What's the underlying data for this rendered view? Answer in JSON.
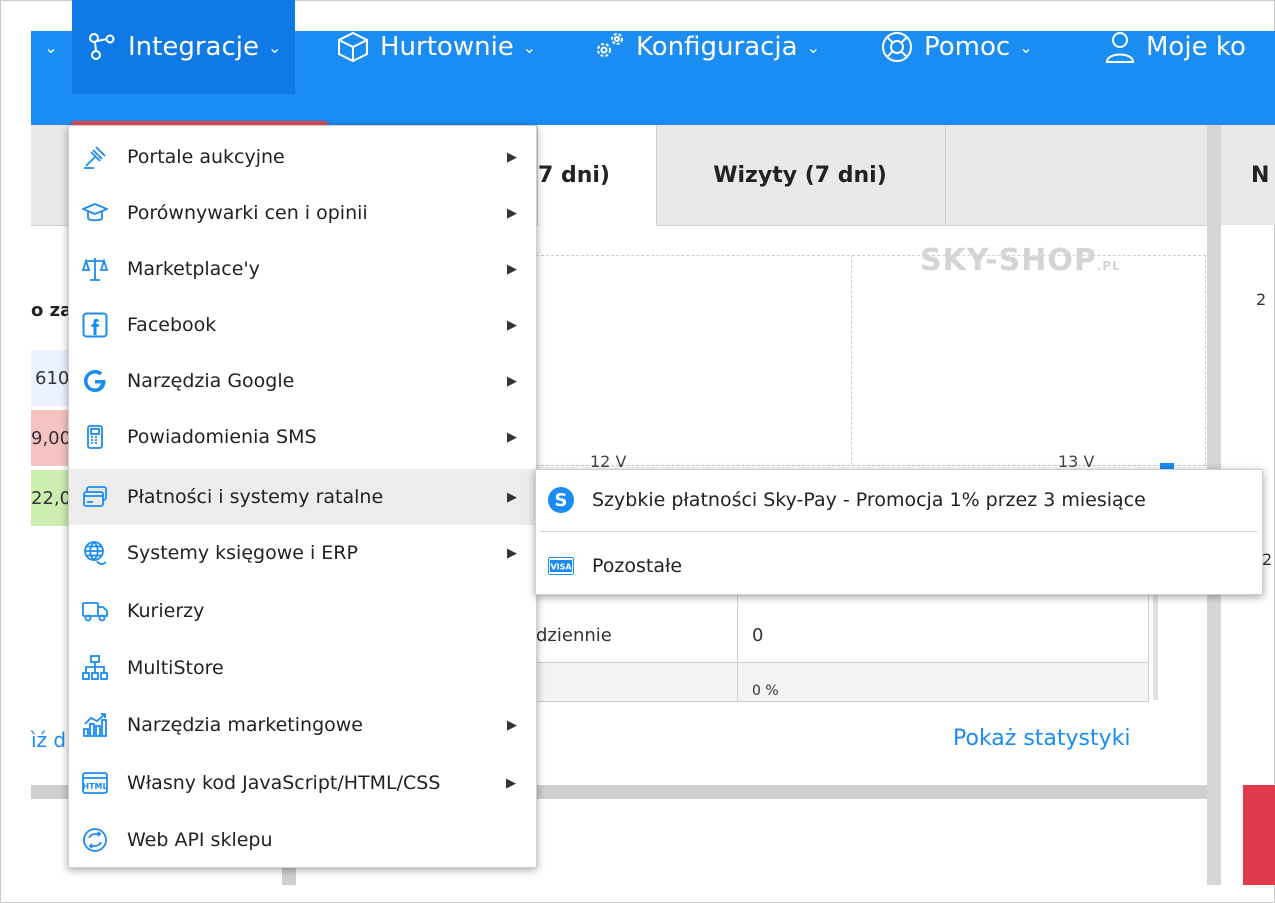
{
  "nav": {
    "items": [
      {
        "label": "Integracje",
        "icon": "integrations-icon"
      },
      {
        "label": "Hurtownie",
        "icon": "box-icon"
      },
      {
        "label": "Konfiguracja",
        "icon": "gears-icon"
      },
      {
        "label": "Pomoc",
        "icon": "lifebuoy-icon"
      },
      {
        "label": "Moje ko",
        "icon": "user-icon"
      }
    ],
    "colors": {
      "bar": "#1a8cf2",
      "active": "#0f79e6",
      "underline": "#e24a50"
    }
  },
  "background": {
    "tab_partial": "7 dni)",
    "tab_visits": "Wizyty (7 dni)",
    "tab_right": "N",
    "watermark": "SKY-SHOP",
    "watermark_suffix": ".PL",
    "axis_left": "12 V",
    "axis_right": "13 V",
    "left_header": "o za",
    "left_val1": "610",
    "left_val2": "9,00",
    "left_val3": "22,0",
    "left_link": "ìź d",
    "row_daily_label": "dziennie",
    "row_daily_value": "0",
    "row_pct_value": "0 %",
    "show_stats": "Pokaż statystyki",
    "right_partial": [
      "2",
      "2"
    ]
  },
  "dropdown": {
    "items": [
      {
        "label": "Portale aukcyjne",
        "icon": "gavel-icon",
        "has_sub": true
      },
      {
        "label": "Porównywarki cen i opinii",
        "icon": "graduation-cap-icon",
        "has_sub": true
      },
      {
        "label": "Marketplace'y",
        "icon": "scales-icon",
        "has_sub": true
      },
      {
        "label": "Facebook",
        "icon": "facebook-icon",
        "has_sub": true
      },
      {
        "label": "Narzędzia Google",
        "icon": "google-icon",
        "has_sub": true
      },
      {
        "label": "Powiadomienia SMS",
        "icon": "phone-icon",
        "has_sub": true
      },
      {
        "label": "Płatności i systemy ratalne",
        "icon": "credit-card-icon",
        "has_sub": true
      },
      {
        "label": "Systemy księgowe i ERP",
        "icon": "globe-icon",
        "has_sub": true
      },
      {
        "label": "Kurierzy",
        "icon": "truck-icon",
        "has_sub": false
      },
      {
        "label": "MultiStore",
        "icon": "sitemap-icon",
        "has_sub": false
      },
      {
        "label": "Narzędzia marketingowe",
        "icon": "chart-icon",
        "has_sub": true
      },
      {
        "label": "Własny kod JavaScript/HTML/CSS",
        "icon": "html-icon",
        "has_sub": true
      },
      {
        "label": "Web API sklepu",
        "icon": "sync-icon",
        "has_sub": false
      }
    ]
  },
  "submenu": {
    "items": [
      {
        "label": "Szybkie płatności Sky-Pay - Promocja 1% przez 3 miesiące",
        "icon": "skypay-icon"
      },
      {
        "label": "Pozostałe",
        "icon": "visa-icon"
      }
    ]
  }
}
